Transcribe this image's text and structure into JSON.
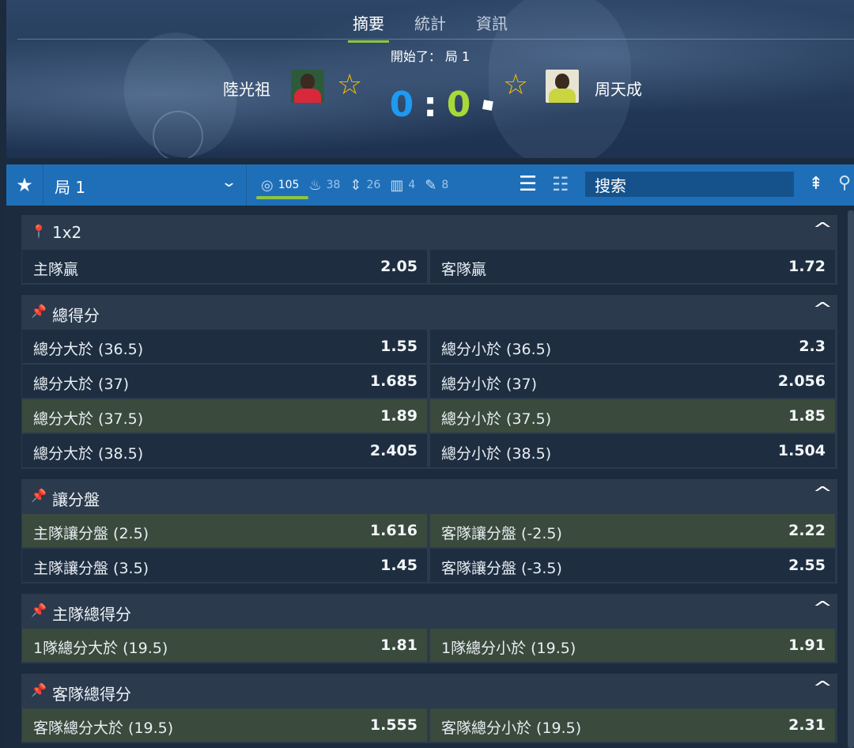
{
  "hero": {
    "tabs": [
      "摘要",
      "統計",
      "資訊"
    ],
    "active_tab": 0,
    "status": "開始了： 局 1",
    "home_name": "陸光祖",
    "away_name": "周天成",
    "home_score": "0",
    "away_score": "0",
    "separator": ":",
    "star_glyph": "☆",
    "colors": {
      "home_score": "#1e9af0",
      "away_score": "#a7d93a",
      "accent": "#8dc63f",
      "star": "#f2c100"
    }
  },
  "toolbar": {
    "period": "局 1",
    "filters": [
      {
        "icon": "target-icon",
        "count": "105"
      },
      {
        "icon": "fire-icon",
        "count": "38"
      },
      {
        "icon": "updown-icon",
        "count": "26"
      },
      {
        "icon": "stats-icon",
        "count": "4"
      },
      {
        "icon": "wand-icon",
        "count": "8"
      }
    ],
    "search_value": "搜索"
  },
  "markets": [
    {
      "title": "1x2",
      "rows": [
        {
          "l": "主隊贏",
          "lo": "2.05",
          "r": "客隊贏",
          "ro": "1.72",
          "hl": false
        }
      ]
    },
    {
      "title": "總得分",
      "rows": [
        {
          "l": "總分大於 (36.5)",
          "lo": "1.55",
          "r": "總分小於 (36.5)",
          "ro": "2.3",
          "hl": false
        },
        {
          "l": "總分大於 (37)",
          "lo": "1.685",
          "r": "總分小於 (37)",
          "ro": "2.056",
          "hl": false
        },
        {
          "l": "總分大於 (37.5)",
          "lo": "1.89",
          "r": "總分小於 (37.5)",
          "ro": "1.85",
          "hl": true
        },
        {
          "l": "總分大於 (38.5)",
          "lo": "2.405",
          "r": "總分小於 (38.5)",
          "ro": "1.504",
          "hl": false
        }
      ]
    },
    {
      "title": "讓分盤",
      "rows": [
        {
          "l": "主隊讓分盤 (2.5)",
          "lo": "1.616",
          "r": "客隊讓分盤 (-2.5)",
          "ro": "2.22",
          "hl": true
        },
        {
          "l": "主隊讓分盤 (3.5)",
          "lo": "1.45",
          "r": "客隊讓分盤 (-3.5)",
          "ro": "2.55",
          "hl": false
        }
      ]
    },
    {
      "title": "主隊總得分",
      "rows": [
        {
          "l": "1隊總分大於 (19.5)",
          "lo": "1.81",
          "r": "1隊總分小於 (19.5)",
          "ro": "1.91",
          "hl": true
        }
      ]
    },
    {
      "title": "客隊總得分",
      "rows": [
        {
          "l": "客隊總分大於 (19.5)",
          "lo": "1.555",
          "r": "客隊總分小於 (19.5)",
          "ro": "2.31",
          "hl": true
        }
      ]
    }
  ]
}
